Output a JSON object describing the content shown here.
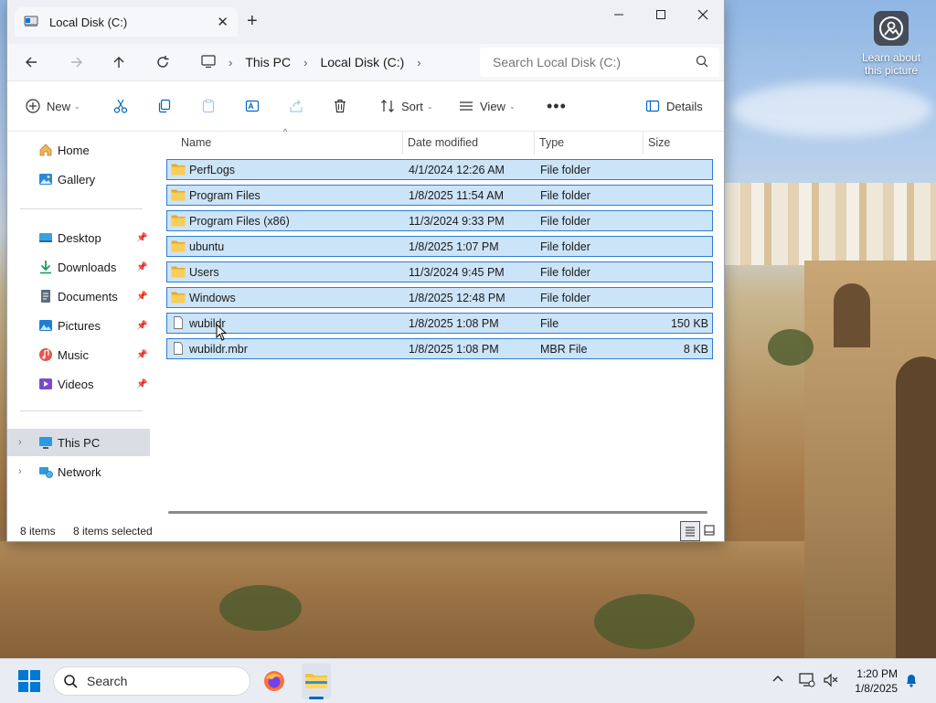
{
  "colors": {
    "accent": "#0067c0",
    "selection_bg": "#cce4f7",
    "selection_border": "#2f7dd1",
    "folder": "#f3c14a"
  },
  "desktop": {
    "learn_label": "Learn about this picture"
  },
  "window": {
    "tab_title": "Local Disk (C:)",
    "breadcrumbs": [
      "This PC",
      "Local Disk (C:)"
    ],
    "search_placeholder": "Search Local Disk (C:)"
  },
  "toolbar": {
    "new": "New",
    "sort": "Sort",
    "view": "View",
    "details": "Details"
  },
  "sidebar": {
    "home": "Home",
    "gallery": "Gallery",
    "quick": [
      "Desktop",
      "Downloads",
      "Documents",
      "Pictures",
      "Music",
      "Videos"
    ],
    "this_pc": "This PC",
    "network": "Network"
  },
  "columns": {
    "name": "Name",
    "date": "Date modified",
    "type": "Type",
    "size": "Size"
  },
  "files": [
    {
      "name": "PerfLogs",
      "date": "4/1/2024 12:26 AM",
      "type": "File folder",
      "size": "",
      "kind": "folder"
    },
    {
      "name": "Program Files",
      "date": "1/8/2025 11:54 AM",
      "type": "File folder",
      "size": "",
      "kind": "folder"
    },
    {
      "name": "Program Files (x86)",
      "date": "11/3/2024 9:33 PM",
      "type": "File folder",
      "size": "",
      "kind": "folder"
    },
    {
      "name": "ubuntu",
      "date": "1/8/2025 1:07 PM",
      "type": "File folder",
      "size": "",
      "kind": "folder"
    },
    {
      "name": "Users",
      "date": "11/3/2024 9:45 PM",
      "type": "File folder",
      "size": "",
      "kind": "folder"
    },
    {
      "name": "Windows",
      "date": "1/8/2025 12:48 PM",
      "type": "File folder",
      "size": "",
      "kind": "folder"
    },
    {
      "name": "wubildr",
      "date": "1/8/2025 1:08 PM",
      "type": "File",
      "size": "150 KB",
      "kind": "file"
    },
    {
      "name": "wubildr.mbr",
      "date": "1/8/2025 1:08 PM",
      "type": "MBR File",
      "size": "8 KB",
      "kind": "file"
    }
  ],
  "status": {
    "count": "8 items",
    "selected": "8 items selected"
  },
  "taskbar": {
    "search": "Search",
    "time": "1:20 PM",
    "date": "1/8/2025"
  }
}
